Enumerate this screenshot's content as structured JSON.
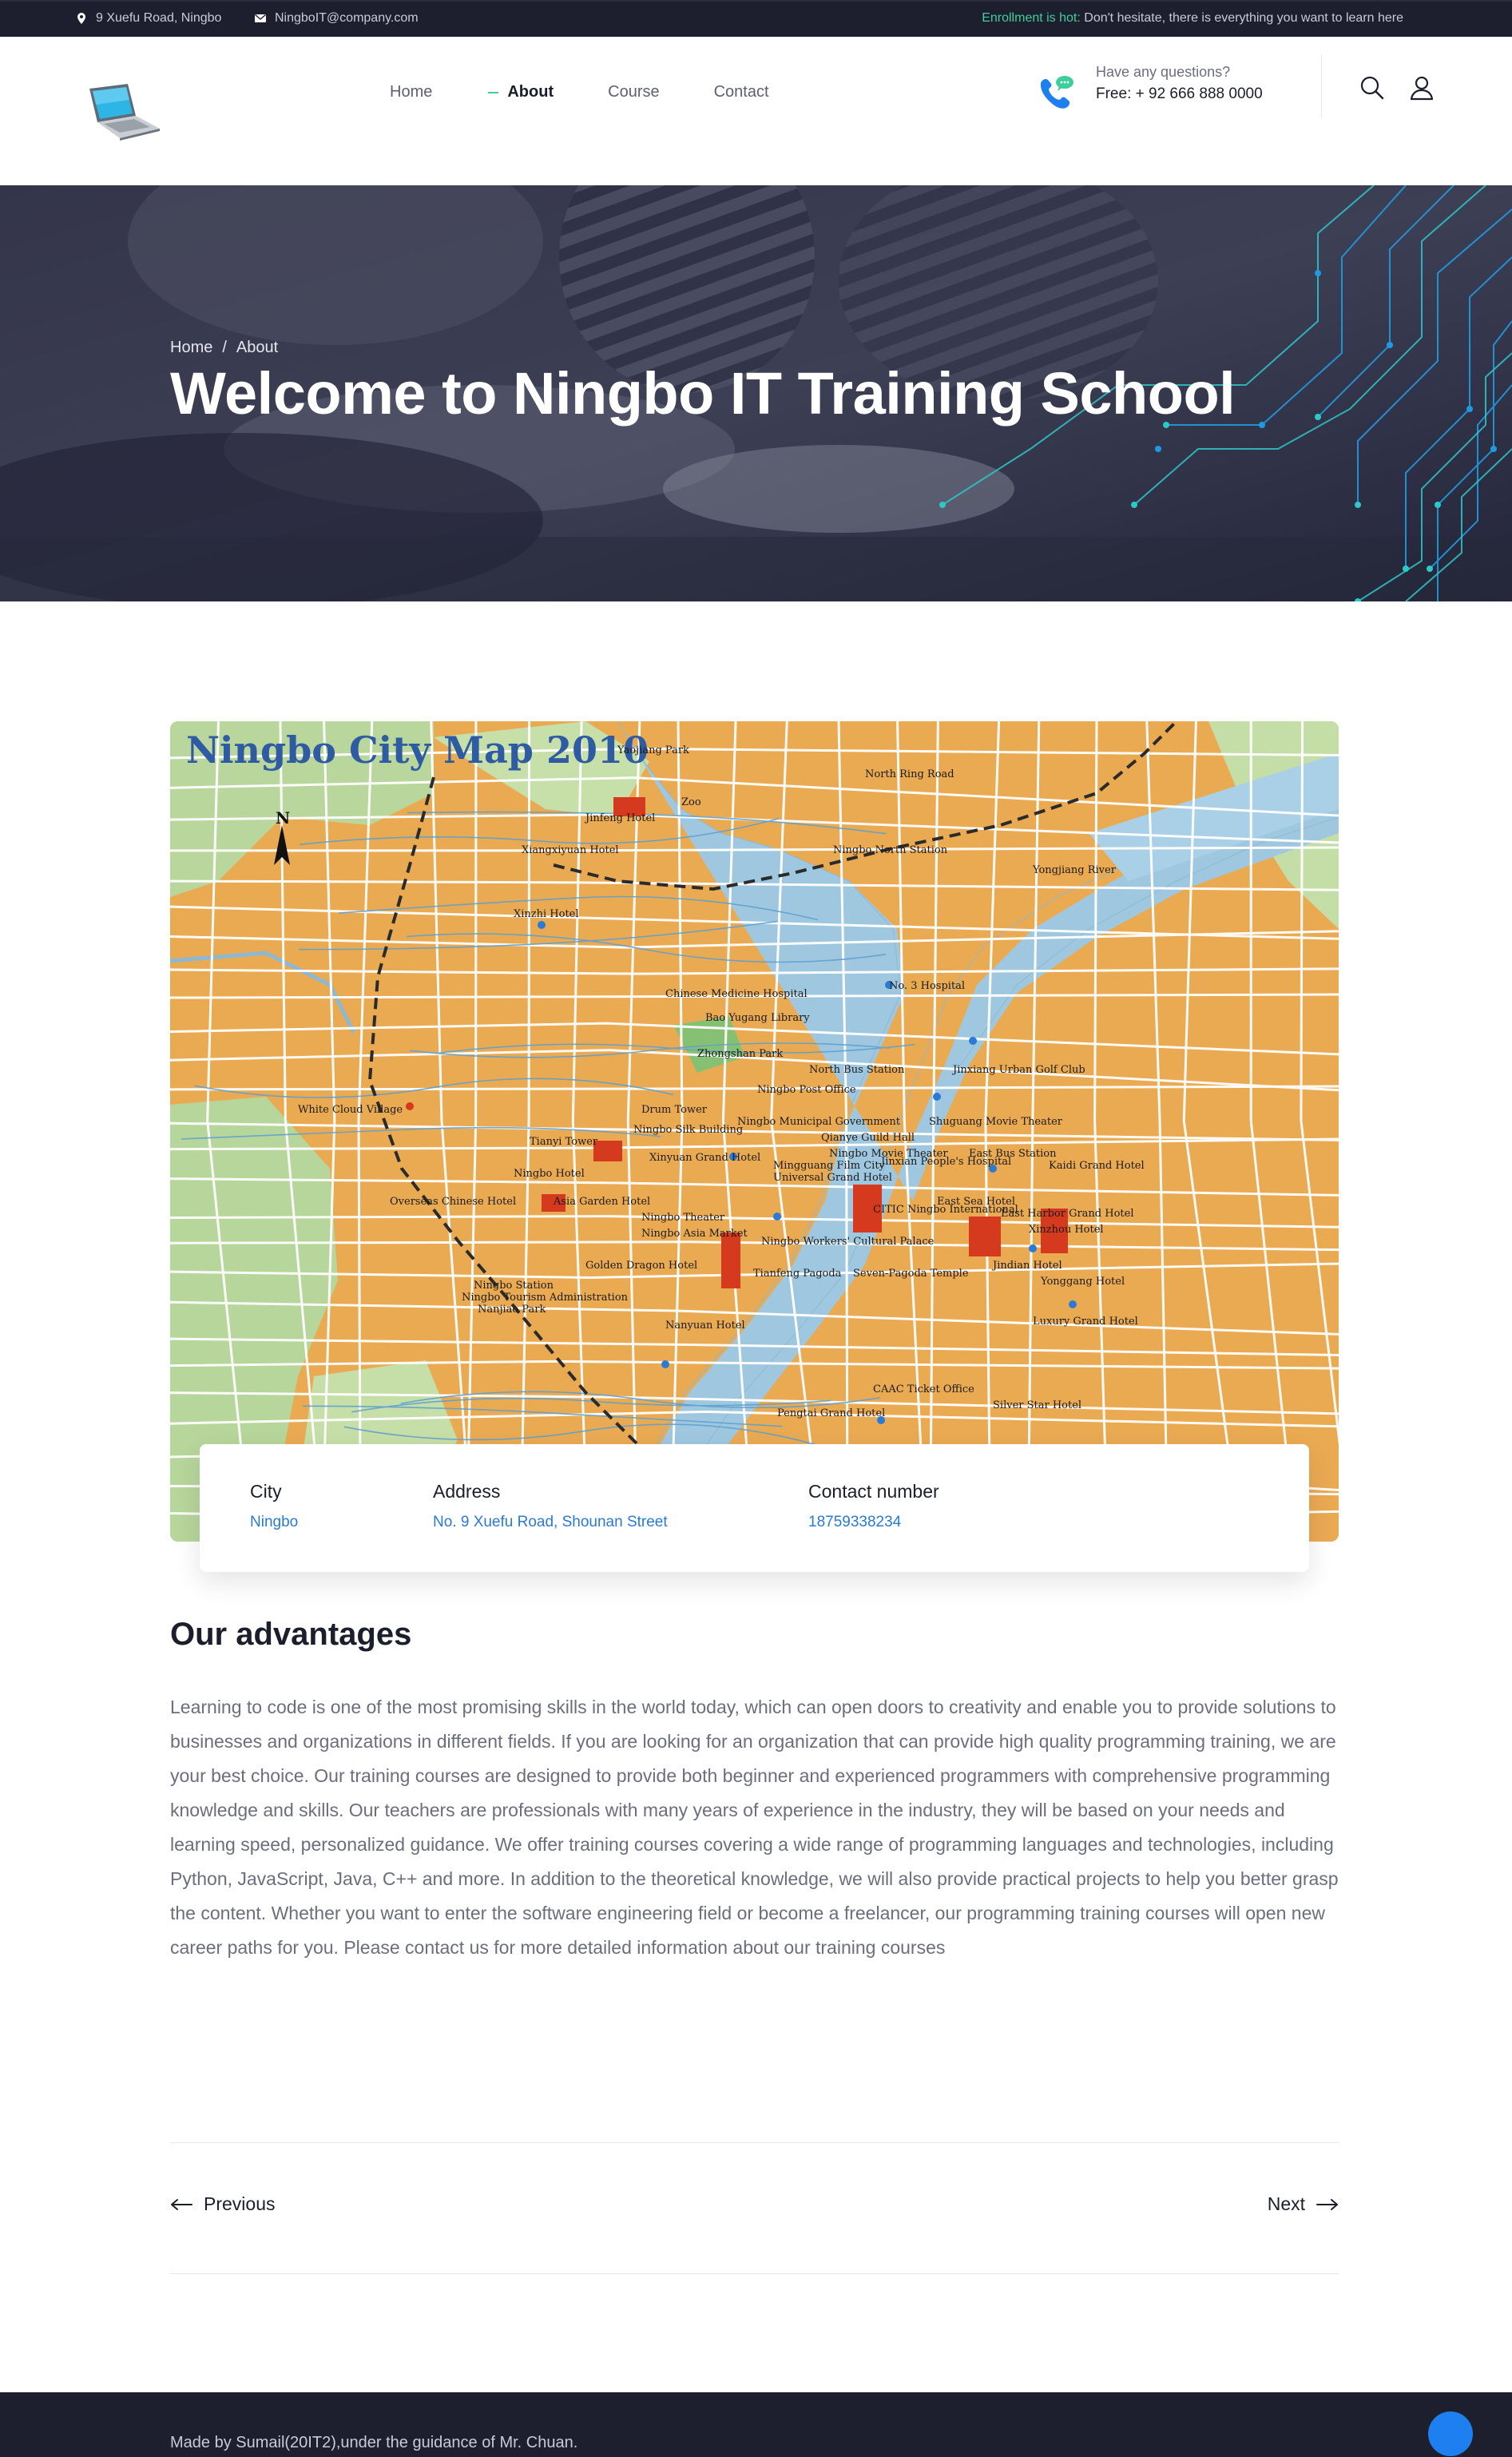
{
  "topbar": {
    "location_icon": "map-pin-icon",
    "location": "9 Xuefu Road, Ningbo",
    "mail_icon": "envelope-icon",
    "email": "NingboIT@company.com",
    "notice_hot": "Enrollment is hot:",
    "notice_text": "Don't hesitate, there is everything you want to learn here"
  },
  "header": {
    "logo_icon": "laptop-icon",
    "nav": [
      {
        "label": "Home",
        "active": false
      },
      {
        "label": "About",
        "active": true
      },
      {
        "label": "Course",
        "active": false
      },
      {
        "label": "Contact",
        "active": false
      }
    ],
    "phone_icon": "phone-chat-icon",
    "question": "Have any questions?",
    "free_line": "Free: + 92 666 888 0000",
    "search_icon": "search-icon",
    "user_icon": "user-icon"
  },
  "hero": {
    "breadcrumb": [
      "Home",
      "/",
      "About"
    ],
    "title": "Welcome to Ningbo IT Training School"
  },
  "map": {
    "title": "Ningbo City Map 2010",
    "north": "N",
    "labels": [
      "Yaojiang Park",
      "North Ring Road",
      "Zoo",
      "Jinfeng Hotel",
      "Xiangxiyuan Hotel",
      "Ningbo North Station",
      "Yongjiang River",
      "Xinzhi Hotel",
      "Chinese Medicine Hospital",
      "No. 3 Hospital",
      "Bao Yugang Library",
      "Zhongshan Park",
      "North Bus Station",
      "Jinxiang Urban Golf Club",
      "Ningbo Post Office",
      "White Cloud Village",
      "Drum Tower",
      "Ningbo Municipal Government",
      "Shuguang Movie Theater",
      "Ningbo Silk Building",
      "Qianye Guild Hall",
      "Ningbo Movie Theater",
      "East Bus Station",
      "Kaidi Grand Hotel",
      "Tianyi Tower",
      "Xinyuan Grand Hotel",
      "Mingguang Film City",
      "Jinxian People's Hospital",
      "Ningbo Hotel",
      "Universal Grand Hotel",
      "Overseas Chinese Hotel",
      "Asia Garden Hotel",
      "East Sea Hotel",
      "Ningbo Theater",
      "CITIC Ningbo International",
      "East Harbor Grand Hotel",
      "Ningbo Asia Market",
      "Ningbo Workers' Cultural Palace",
      "Xinzhou Hotel",
      "Golden Dragon Hotel",
      "Jindian Hotel",
      "Tianfeng Pagoda",
      "Seven-Pagoda Temple",
      "Yonggang Hotel",
      "Ningbo Station",
      "Ningbo Tourism Administration",
      "Nanjiao Park",
      "Nanyuan Hotel",
      "Luxury Grand Hotel",
      "CAAC Ticket Office",
      "Pengtai Grand Hotel",
      "Silver Star Hotel"
    ]
  },
  "info": {
    "city_label": "City",
    "city_value": "Ningbo",
    "address_label": "Address",
    "address_value": "No. 9 Xuefu Road, Shounan Street",
    "contact_label": "Contact number",
    "contact_value": "18759338234"
  },
  "advantages": {
    "title": "Our advantages",
    "text": "Learning to code is one of the most promising skills in the world today, which can open doors to creativity and enable you to provide solutions to businesses and organizations in different fields. If you are looking for an organization that can provide high quality programming training, we are your best choice. Our training courses are designed to provide both beginner and experienced programmers with comprehensive programming knowledge and skills. Our teachers are professionals with many years of experience in the industry, they will be based on your needs and learning speed, personalized guidance. We offer training courses covering a wide range of programming languages and technologies, including Python, JavaScript, Java, C++ and more. In addition to the theoretical knowledge, we will also provide practical projects to help you better grasp the content. Whether you want to enter the software engineering field or become a freelancer, our programming training courses will open new career paths for you. Please contact us for more detailed information about our training courses"
  },
  "pager": {
    "prev": "Previous",
    "next": "Next",
    "prev_icon": "arrow-left-icon",
    "next_icon": "arrow-right-icon"
  },
  "footer": {
    "credit": "Made by Sumail(20IT2),under the guidance of Mr. Chuan.",
    "totop_icon": "back-to-top-icon"
  },
  "colors": {
    "dark": "#1e1f2e",
    "accent_green": "#3ccf9a",
    "link_blue": "#2a7ad6",
    "totop_blue": "#1e7ff0",
    "text_gray": "#6b6e7c"
  }
}
